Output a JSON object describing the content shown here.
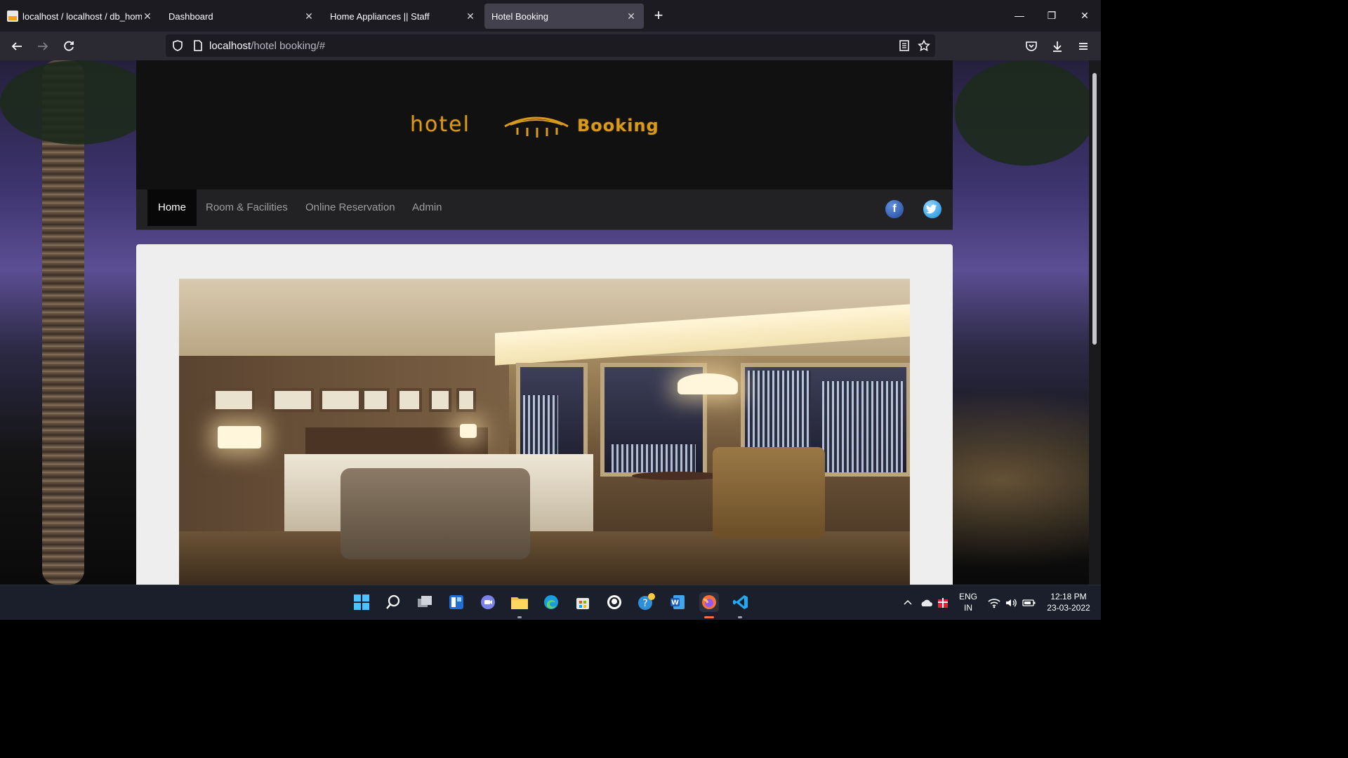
{
  "browser": {
    "tabs": [
      {
        "title": "localhost / localhost / db_home",
        "active": false
      },
      {
        "title": "Dashboard",
        "active": false
      },
      {
        "title": "Home Appliances || Staff",
        "active": false
      },
      {
        "title": "Hotel Booking",
        "active": true
      }
    ],
    "new_tab_icon": "plus-icon",
    "url_host": "localhost",
    "url_path": "/hotel booking/#"
  },
  "site": {
    "logo_word1": "hotel",
    "logo_word2": "Booking",
    "menu": [
      "Home",
      "Room & Facilities",
      "Online Reservation",
      "Admin"
    ],
    "active_menu": "Home",
    "social": [
      "f",
      "t"
    ]
  },
  "taskbar": {
    "lang_line1": "ENG",
    "lang_line2": "IN",
    "time": "12:18 PM",
    "date": "23-03-2022"
  },
  "colors": {
    "logo_gold": "#d89a1c",
    "menu_bg": "#222224",
    "content_bg": "#eeeeee"
  }
}
